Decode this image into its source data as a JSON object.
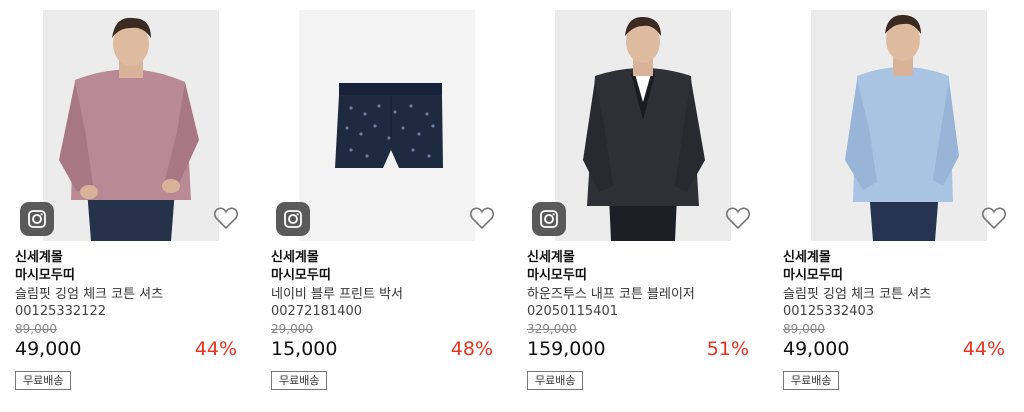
{
  "products": [
    {
      "mall": "신세계몰",
      "brand": "마시모두띠",
      "name": "슬림핏 깅엄 체크 코튼 셔츠",
      "code": "00125332122",
      "original_price": "89,000",
      "price": "49,000",
      "discount": "44%",
      "badge": "무료배송",
      "shirt_color": "#b98a96",
      "pants_color": "#25324a",
      "bg_color": "#ececec"
    },
    {
      "mall": "신세계몰",
      "brand": "마시모두띠",
      "name": "네이비 블루 프린트 박서",
      "code": "00272181400",
      "original_price": "29,000",
      "price": "15,000",
      "discount": "48%",
      "badge": "무료배송",
      "shirt_color": "#1e2a40",
      "pants_color": "#1e2a40",
      "bg_color": "#f3f3f3"
    },
    {
      "mall": "신세계몰",
      "brand": "마시모두띠",
      "name": "하운즈투스 내프 코튼 블레이저",
      "code": "02050115401",
      "original_price": "329,000",
      "price": "159,000",
      "discount": "51%",
      "badge": "무료배송",
      "shirt_color": "#2e3036",
      "pants_color": "#1d1f26",
      "bg_color": "#ececec"
    },
    {
      "mall": "신세계몰",
      "brand": "마시모두띠",
      "name": "슬림핏 깅엄 체크 코튼 셔츠",
      "code": "00125332403",
      "original_price": "89,000",
      "price": "49,000",
      "discount": "44%",
      "badge": "무료배송",
      "shirt_color": "#a9c3e2",
      "pants_color": "#263350",
      "bg_color": "#ececec"
    }
  ],
  "icons": {
    "photo": "instagram-icon",
    "wishlist": "heart-outline-icon"
  },
  "colors": {
    "discount": "#e8331f",
    "badge_border": "#777777"
  }
}
